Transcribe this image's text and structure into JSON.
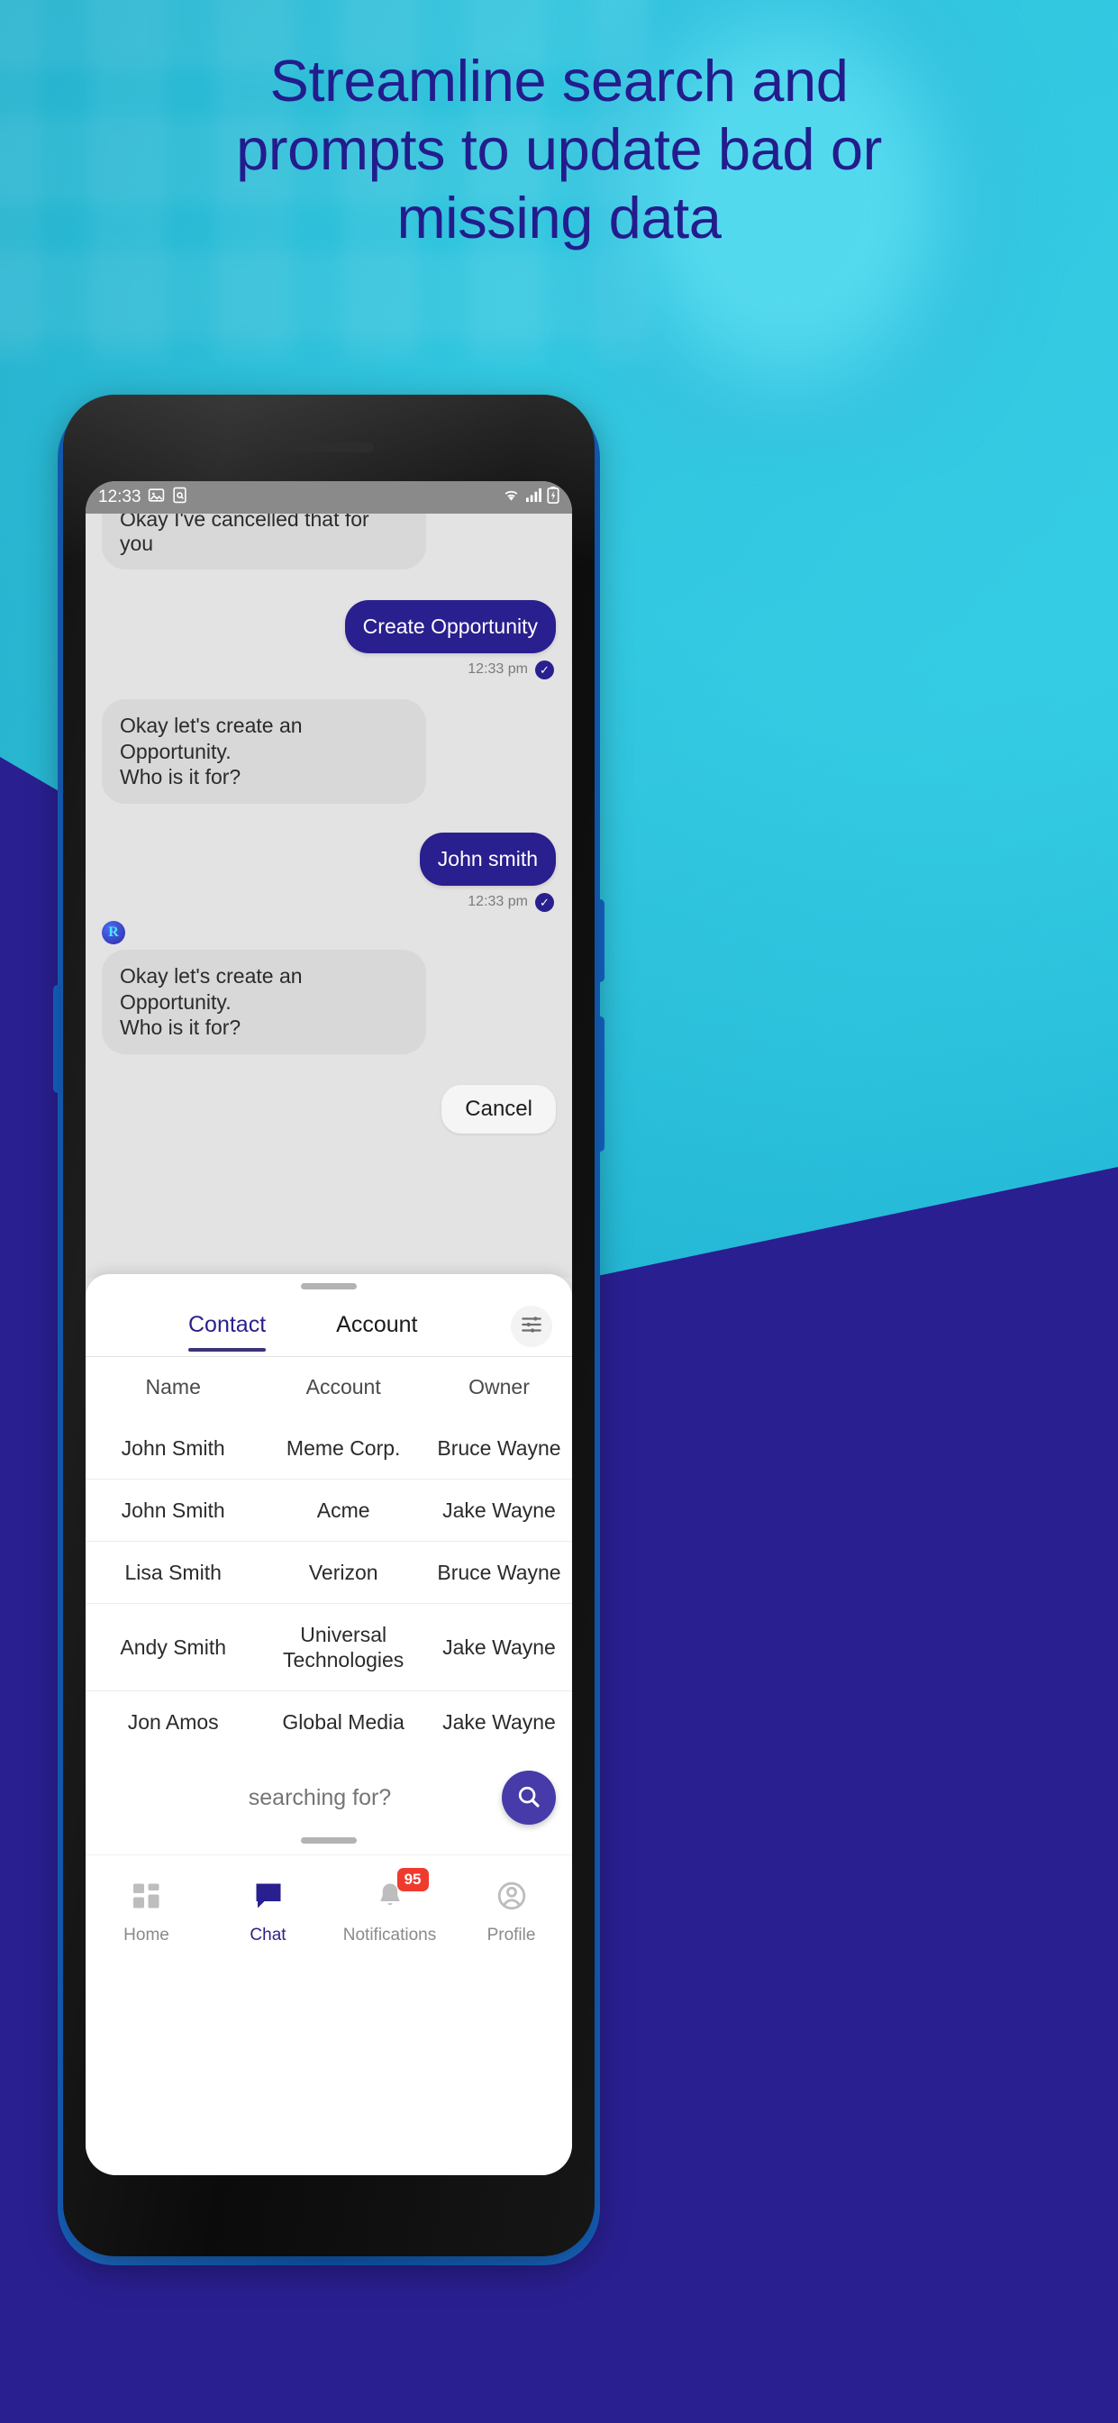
{
  "headline": {
    "line1": "Streamline search and",
    "line2": "prompts to update bad or",
    "line3": "missing data",
    "color": "#231C8C"
  },
  "theme": {
    "cyan": "#22B5CE",
    "navy": "#2A1F91",
    "phone_rail_blue": "#1565C8",
    "accent": "#2A1F8E",
    "badge_red": "#EF3B2D"
  },
  "status_bar": {
    "time": "12:33",
    "left_icons": [
      "image-icon",
      "screenshot-search-icon"
    ],
    "right_icons": [
      "wifi-icon",
      "signal-icon",
      "battery-charging-icon"
    ]
  },
  "chat": {
    "messages": [
      {
        "id": "m0",
        "from": "bot",
        "text": "Okay I've cancelled that for you",
        "time": "",
        "partial": true
      },
      {
        "id": "m1",
        "from": "me",
        "text": "Create Opportunity",
        "time": "12:33 pm",
        "status_icon": "check-icon"
      },
      {
        "id": "m2",
        "from": "bot",
        "text": "Okay let's create an Opportunity.\nWho is it for?",
        "time": ""
      },
      {
        "id": "m3",
        "from": "me",
        "text": "John smith",
        "time": "12:33 pm",
        "status_icon": "check-icon"
      },
      {
        "id": "m4",
        "from": "bot",
        "text": "Okay let's create an Opportunity.\nWho is it for?",
        "time": "",
        "avatar": "R"
      }
    ],
    "cancel_label": "Cancel"
  },
  "sheet": {
    "tabs": [
      {
        "label": "Contact",
        "active": true
      },
      {
        "label": "Account",
        "active": false
      }
    ],
    "filter_icon": "sliders-icon",
    "table": {
      "columns": [
        "Name",
        "Account",
        "Owner"
      ],
      "rows": [
        [
          "John Smith",
          "Meme Corp.",
          "Bruce Wayne"
        ],
        [
          "John Smith",
          "Acme",
          "Jake Wayne"
        ],
        [
          "Lisa Smith",
          "Verizon",
          "Bruce Wayne"
        ],
        [
          "Andy Smith",
          "Universal\nTechnologies",
          "Jake Wayne"
        ],
        [
          "Jon Amos",
          "Global Media",
          "Jake Wayne"
        ]
      ]
    },
    "search": {
      "value": "",
      "placeholder": "searching for?",
      "button_icon": "search-icon"
    }
  },
  "bottom_nav": [
    {
      "label": "Home",
      "icon": "grid-icon",
      "active": false,
      "badge": ""
    },
    {
      "label": "Chat",
      "icon": "chat-bubble-icon",
      "active": true,
      "badge": ""
    },
    {
      "label": "Notifications",
      "icon": "bell-icon",
      "active": false,
      "badge": "95"
    },
    {
      "label": "Profile",
      "icon": "person-icon",
      "active": false,
      "badge": ""
    }
  ]
}
